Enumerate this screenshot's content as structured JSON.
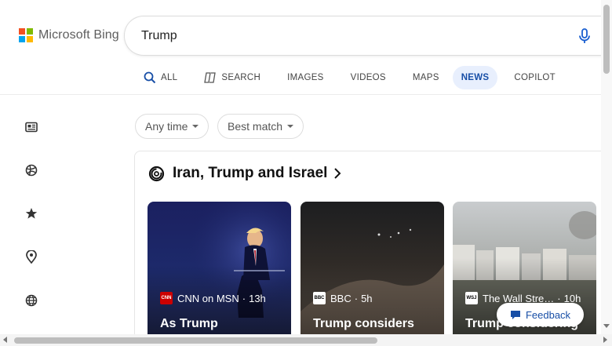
{
  "brand": {
    "logo_text": "Microsoft Bing",
    "square_colors": [
      "#f25022",
      "#7fba00",
      "#00a4ef",
      "#ffb900"
    ]
  },
  "search": {
    "query": "Trump",
    "mic_icon": "microphone-icon"
  },
  "tabs": [
    {
      "label": "ALL",
      "icon": "search-icon"
    },
    {
      "label": "SEARCH",
      "icon": "copilot-search-icon"
    },
    {
      "label": "IMAGES"
    },
    {
      "label": "VIDEOS"
    },
    {
      "label": "MAPS"
    },
    {
      "label": "NEWS",
      "active": true
    },
    {
      "label": "COPILOT"
    }
  ],
  "sidebar": {
    "icons": [
      "top-stories-icon",
      "sports-icon",
      "favorites-star-icon",
      "location-pin-icon",
      "world-globe-icon"
    ]
  },
  "filters": {
    "time": "Any time",
    "sort": "Best match"
  },
  "topic": {
    "title": "Iran, Trump and Israel"
  },
  "cards": [
    {
      "source": "CNN on MSN",
      "age": "13h",
      "headline": "As Trump",
      "logo": "CNN"
    },
    {
      "source": "BBC",
      "age": "5h",
      "headline": "Trump considers",
      "logo": "BBC"
    },
    {
      "source": "The Wall Stre…",
      "age": "10h",
      "headline": "Trump considering",
      "logo": "WSJ"
    }
  ],
  "feedback": {
    "label": "Feedback"
  },
  "colors": {
    "accent": "#174ea6",
    "active_tab_bg": "#e8effd"
  }
}
